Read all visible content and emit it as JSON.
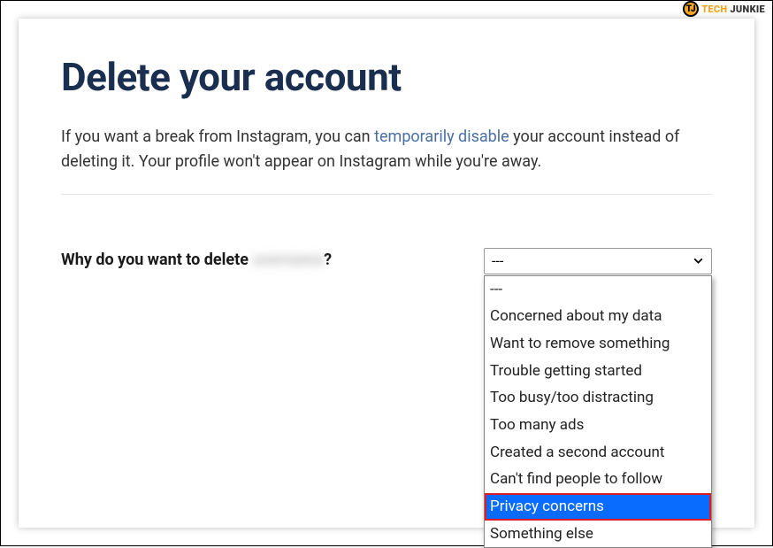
{
  "watermark": {
    "icon_letter": "TJ",
    "text1": "TECH",
    "text2": "JUNKIE"
  },
  "heading": "Delete your account",
  "description": {
    "prefix": "If you want a break from Instagram, you can ",
    "link_text": "temporarily disable",
    "suffix": " your account instead of deleting it. Your profile won't appear on Instagram while you're away."
  },
  "question": {
    "prefix": "Why do you want to delete ",
    "blurred": "username",
    "suffix": "?"
  },
  "select": {
    "selected": "---",
    "options": [
      "---",
      "Concerned about my data",
      "Want to remove something",
      "Trouble getting started",
      "Too busy/too distracting",
      "Too many ads",
      "Created a second account",
      "Can't find people to follow",
      "Privacy concerns",
      "Something else"
    ],
    "highlighted_index": 8
  }
}
